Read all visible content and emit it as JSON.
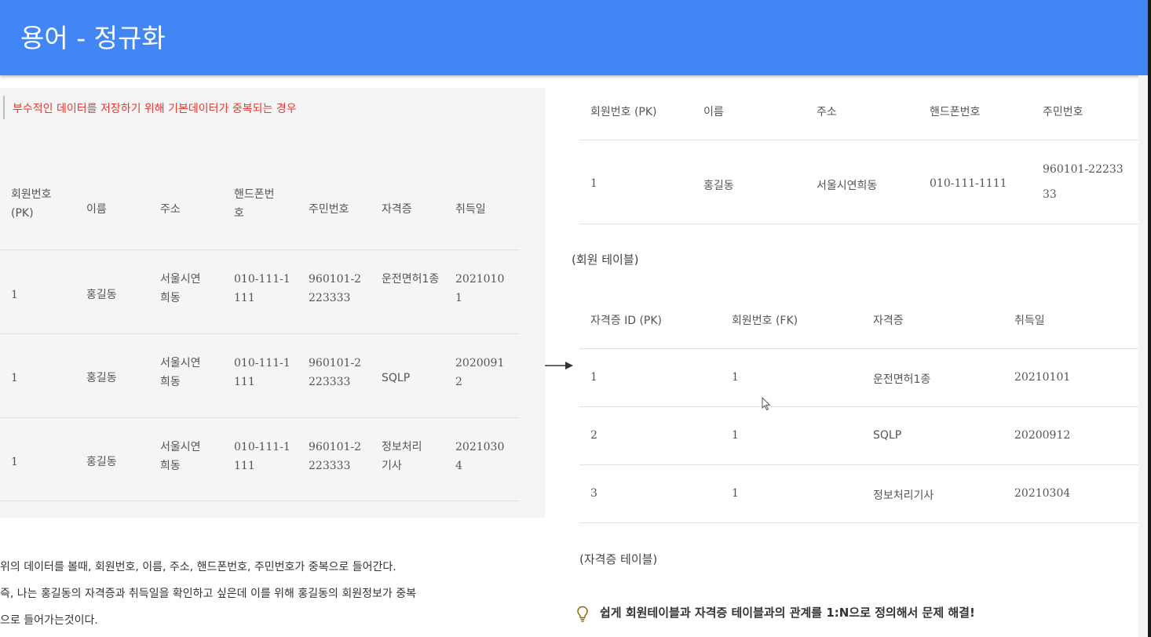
{
  "header": {
    "title": "용어 - 정규화"
  },
  "left": {
    "callout": "부수적인 데이터를 저장하기 위해 기본데이터가 중복되는 경우",
    "columns": [
      "회원번호 (PK)",
      "이름",
      "주소",
      "핸드폰번호",
      "주민번호",
      "자격증",
      "취득일"
    ],
    "rows": [
      [
        "1",
        "홍길동",
        "서울시연희동",
        "010-111-1111",
        "960101-2223333",
        "운전면허1종",
        "20210101"
      ],
      [
        "1",
        "홍길동",
        "서울시연희동",
        "010-111-1111",
        "960101-2223333",
        "SQLP",
        "20200912"
      ],
      [
        "1",
        "홍길동",
        "서울시연희동",
        "010-111-1111",
        "960101-2223333",
        "정보처리기사",
        "20210304"
      ]
    ],
    "explanation": [
      "위의 데이터를 볼때, 회원번호, 이름, 주소, 핸드폰번호, 주민번호가 중복으로 들어간다.",
      "즉, 나는 홍길동의 자격증과 취득일을 확인하고 싶은데 이를 위해 홍길동의 회원정보가 중복",
      "으로 들어가는것이다."
    ]
  },
  "member_table": {
    "columns": [
      "회원번호 (PK)",
      "이름",
      "주소",
      "핸드폰번호",
      "주민번호"
    ],
    "row": [
      "1",
      "홍길동",
      "서울시연희동",
      "010-111-1111",
      "960101-22233",
      "33"
    ],
    "caption": "(회원 테이블)"
  },
  "cert_table": {
    "columns": [
      "자격증 ID (PK)",
      "회원번호 (FK)",
      "자격증",
      "취득일"
    ],
    "rows": [
      [
        "1",
        "1",
        "운전면허1종",
        "20210101"
      ],
      [
        "2",
        "1",
        "SQLP",
        "20200912"
      ],
      [
        "3",
        "1",
        "정보처리기사",
        "20210304"
      ]
    ],
    "caption": "(자격증 테이블)"
  },
  "tip": "쉽게 회원테이블과 자격증 테이블과의 관계를 1:N으로 정의해서 문제 해결!",
  "colors": {
    "header_bg": "#4285f4",
    "callout_text": "#e53935",
    "panel_bg": "#f5f5f5"
  },
  "icons": {
    "tip": "lightbulb-icon",
    "arrow": "arrow-right-icon",
    "cursor": "mouse-cursor-icon"
  }
}
